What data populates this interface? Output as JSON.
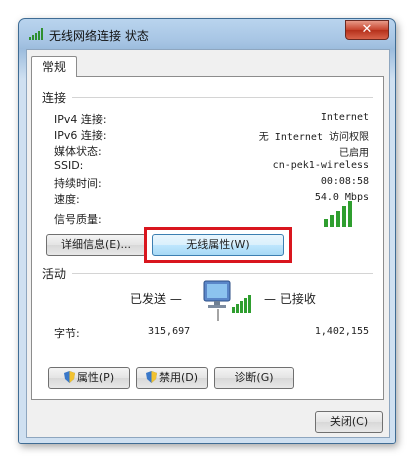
{
  "window": {
    "title": "无线网络连接 状态",
    "close_symbol": "✕"
  },
  "tabs": [
    {
      "label": "常规"
    }
  ],
  "connection": {
    "section_label": "连接",
    "rows": [
      {
        "label": "IPv4 连接:",
        "value": "Internet"
      },
      {
        "label": "IPv6 连接:",
        "value": "无 Internet 访问权限"
      },
      {
        "label": "媒体状态:",
        "value": "已启用"
      },
      {
        "label": "SSID:",
        "value": "cn-pek1-wireless"
      },
      {
        "label": "持续时间:",
        "value": "00:08:58"
      },
      {
        "label": "速度:",
        "value": "54.0 Mbps"
      }
    ],
    "signal_label": "信号质量:",
    "signal_icon": "signal-strength-icon",
    "details_button": "详细信息(E)...",
    "wireless_props_button": "无线属性(W)"
  },
  "activity": {
    "section_label": "活动",
    "sent_label": "已发送 —",
    "received_label": "— 已接收",
    "bytes_label": "字节:",
    "bytes_sent": "315,697",
    "bytes_received": "1,402,155",
    "network_icon": "network-computer-icon"
  },
  "buttons": {
    "properties": "属性(P)",
    "disable": "禁用(D)",
    "diagnose": "诊断(G)",
    "close": "关闭(C)"
  },
  "colors": {
    "highlight": "#d9161e",
    "signal_bar": "#2f9e2f"
  }
}
